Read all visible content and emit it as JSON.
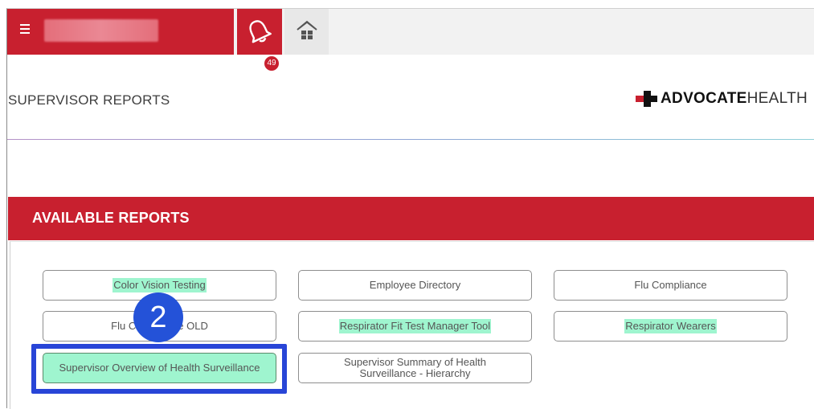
{
  "topbar": {
    "notifications_count": "49",
    "icons": {
      "menu": "hamburger-menu-icon",
      "bell": "bell-icon",
      "home": "home-icon"
    }
  },
  "header": {
    "page_title": "SUPERVISOR REPORTS",
    "logo": {
      "bold": "ADVOCATE",
      "light": "HEALTH"
    }
  },
  "panel": {
    "title": "AVAILABLE REPORTS",
    "reports": [
      {
        "label": "Color Vision Testing"
      },
      {
        "label": "Employee Directory"
      },
      {
        "label": "Flu Compliance"
      },
      {
        "label": "Flu Compliance OLD"
      },
      {
        "label": "Respirator Fit Test Manager Tool"
      },
      {
        "label": "Respirator Wearers"
      },
      {
        "label": "Supervisor Overview of Health Surveillance"
      },
      {
        "label": "Supervisor Summary of Health Surveillance - Hierarchy"
      }
    ]
  },
  "annotation": {
    "step": "2"
  },
  "colors": {
    "brand_red": "#c8202f",
    "highlight": "#9ff5cf",
    "annotation_blue": "#2845d7"
  }
}
